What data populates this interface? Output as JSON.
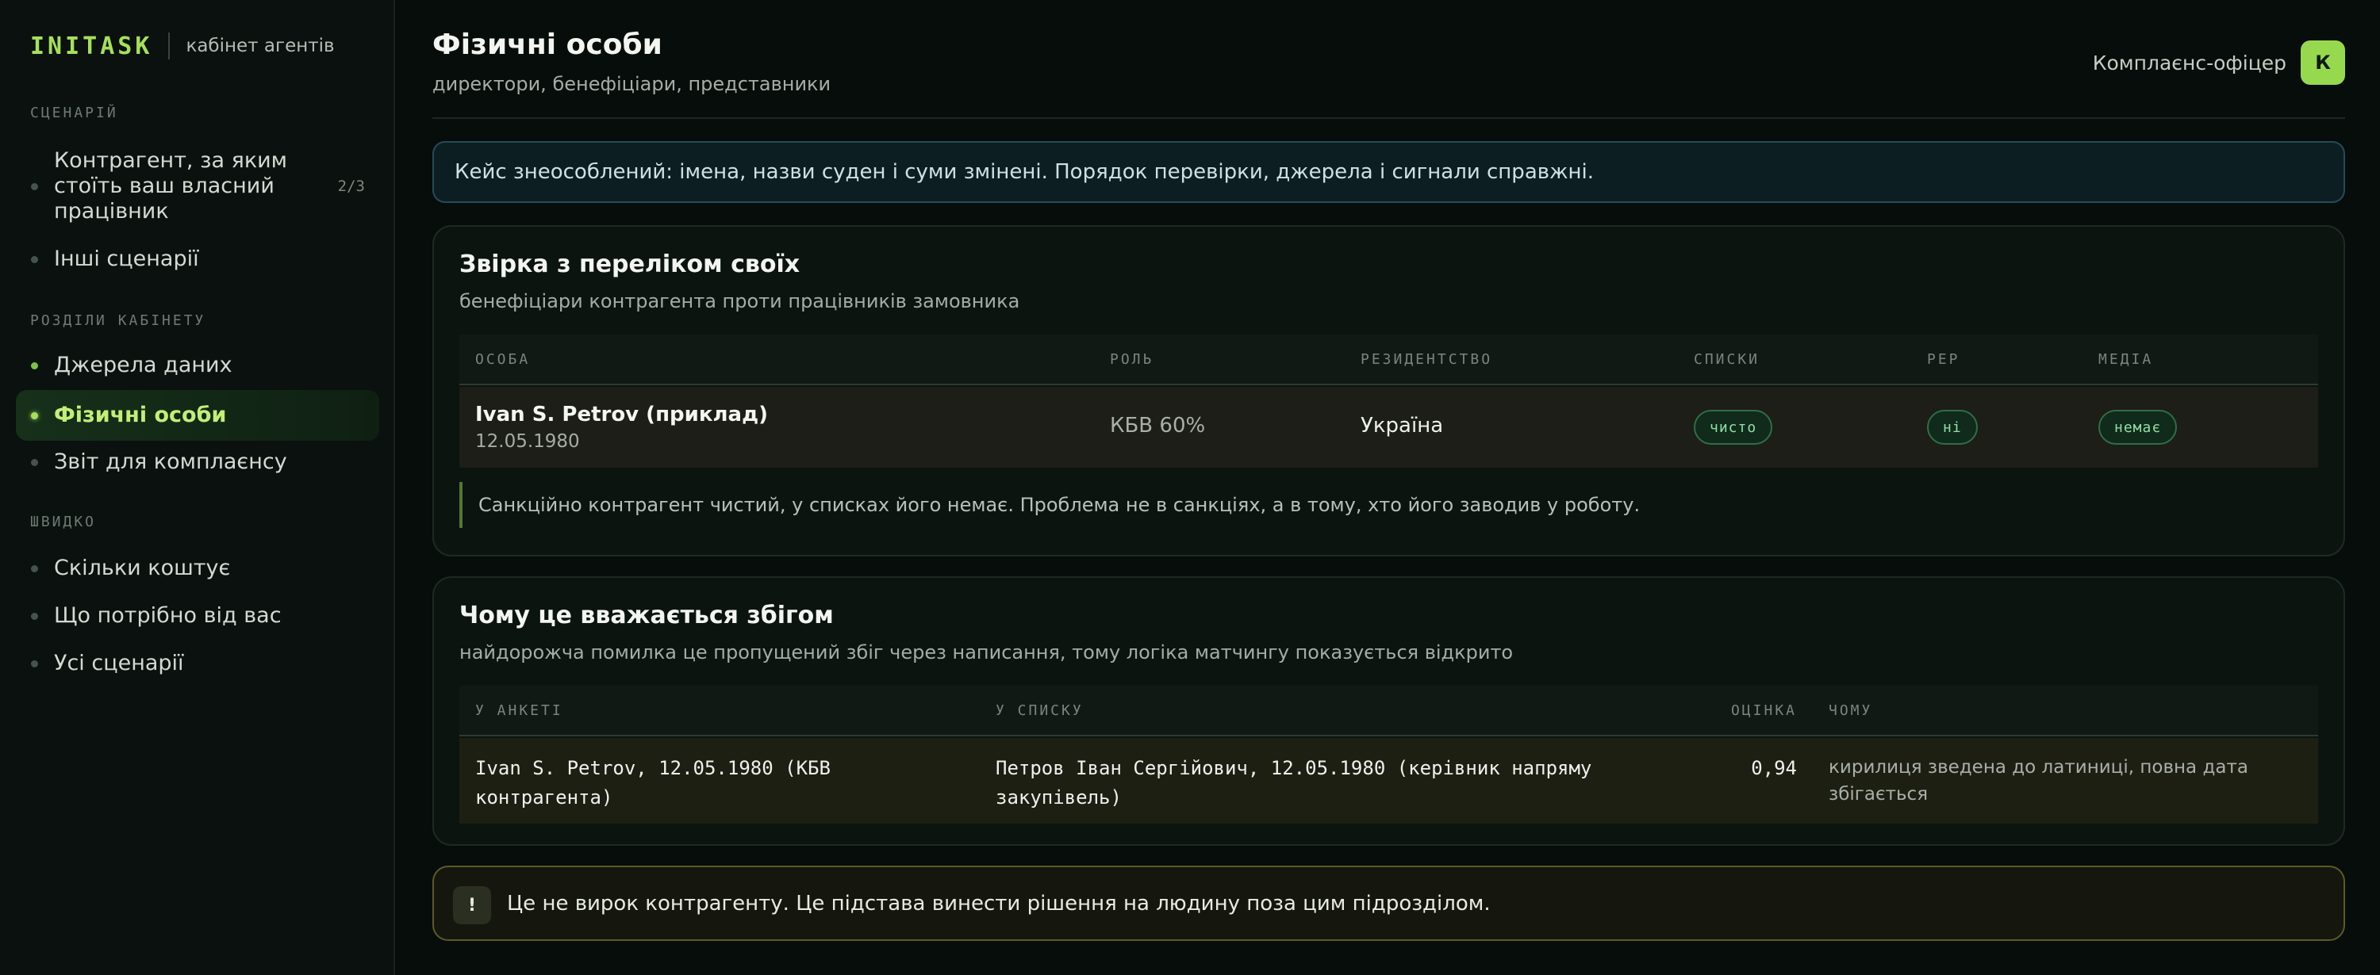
{
  "brand": {
    "logo": "INITASK",
    "subtitle": "кабінет агентів"
  },
  "sidebar": {
    "section_scenario": "СЦЕНАРІЙ",
    "scenario_items": [
      {
        "label": "Контрагент, за яким стоїть ваш власний працівник",
        "count": "2/3"
      },
      {
        "label": "Інші сценарії"
      }
    ],
    "section_cabinet": "РОЗДІЛИ КАБІНЕТУ",
    "cabinet_items": [
      {
        "label": "Джерела даних"
      },
      {
        "label": "Фізичні особи"
      },
      {
        "label": "Звіт для комплаєнсу"
      }
    ],
    "section_quick": "ШВИДКО",
    "quick_items": [
      {
        "label": "Скільки коштує"
      },
      {
        "label": "Що потрібно від вас"
      },
      {
        "label": "Усі сценарії"
      }
    ]
  },
  "header": {
    "title": "Фізичні особи",
    "subtitle": "директори, бенефіціари, представники",
    "user_role": "Комплаєнс-офіцер",
    "avatar_initial": "К"
  },
  "notice": "Кейс знеособлений: імена, назви суден і суми змінені. Порядок перевірки, джерела і сигнали справжні.",
  "reconciliation": {
    "title": "Звірка з переліком своїх",
    "subtitle": "бенефіціари контрагента проти працівників замовника",
    "columns": [
      "ОСОБА",
      "РОЛЬ",
      "РЕЗИДЕНТСТВО",
      "СПИСКИ",
      "PEP",
      "МЕДІА"
    ],
    "row": {
      "name": "Ivan S. Petrov (приклад)",
      "dob": "12.05.1980",
      "role": "КБВ 60%",
      "residency": "Україна",
      "lists": "чисто",
      "pep": "ні",
      "media": "немає"
    },
    "note": "Санкційно контрагент чистий, у списках його немає. Проблема не в санкціях, а в тому, хто його заводив у роботу."
  },
  "match": {
    "title": "Чому це вважається збігом",
    "subtitle": "найдорожча помилка це пропущений збіг через написання, тому логіка матчингу показується відкрито",
    "columns": [
      "У АНКЕТІ",
      "У СПИСКУ",
      "ОЦІНКА",
      "ЧОМУ"
    ],
    "row": {
      "profile": "Ivan S. Petrov, 12.05.1980 (КБВ контрагента)",
      "list": "Петров Іван Сергійович, 12.05.1980 (керівник напряму закупівель)",
      "score": "0,94",
      "why": "кирилиця зведена до латиниці, повна дата збігається"
    }
  },
  "warning": {
    "icon": "!",
    "text": "Це не вирок контрагенту. Це підстава винести рішення на людину поза цим підрозділом."
  },
  "colors": {
    "accent": "#a6e05a",
    "pill_green": "#8fe0a7",
    "notice_border": "#264b5a",
    "warning_border": "#5c5a28"
  }
}
